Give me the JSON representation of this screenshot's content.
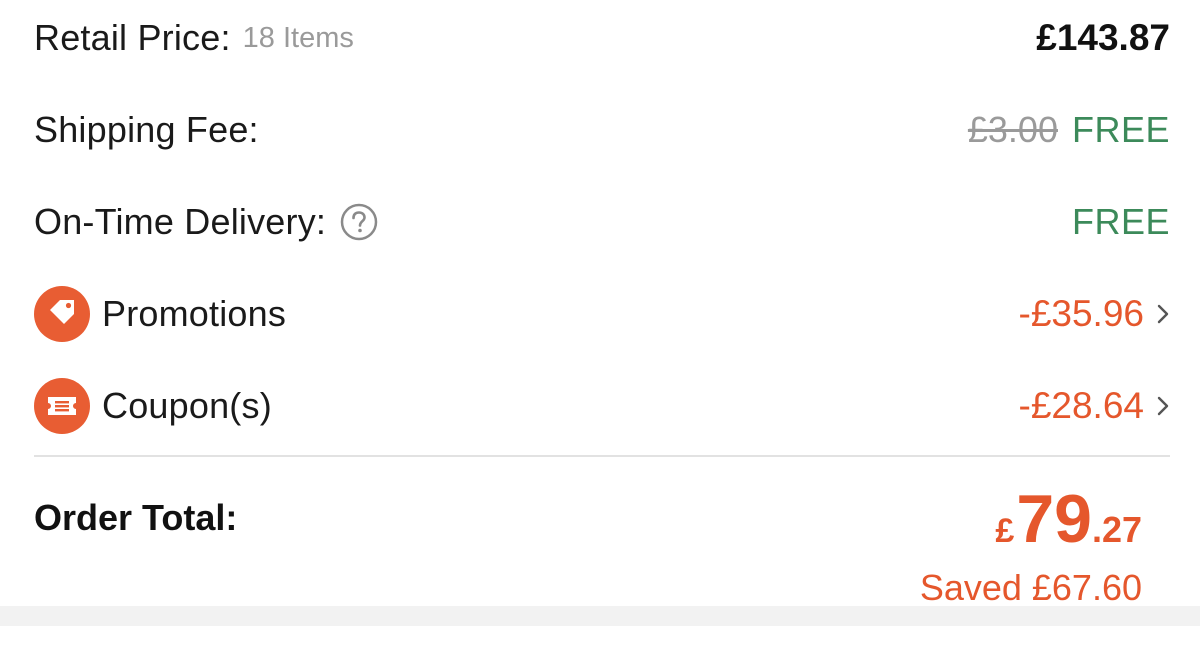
{
  "summary": {
    "retail": {
      "label": "Retail Price:",
      "items": "18 Items",
      "amount": "£143.87"
    },
    "shipping": {
      "label": "Shipping Fee:",
      "old": "£3.00",
      "value": "FREE"
    },
    "delivery": {
      "label": "On-Time Delivery:",
      "value": "FREE",
      "icon": "question-circle-icon"
    },
    "promotions": {
      "label": "Promotions",
      "amount": "-£35.96",
      "icon": "tag-icon"
    },
    "coupons": {
      "label": "Coupon(s)",
      "amount": "-£28.64",
      "icon": "coupon-ticket-icon"
    },
    "total": {
      "label": "Order Total:",
      "currency": "£",
      "integer": "79",
      "decimal": ".27",
      "saved": "Saved £67.60"
    }
  },
  "colors": {
    "accent_orange": "#e5572c",
    "free_green": "#3c8a5a",
    "muted_gray": "#9a9a9a",
    "divider": "#e2e2e2"
  }
}
